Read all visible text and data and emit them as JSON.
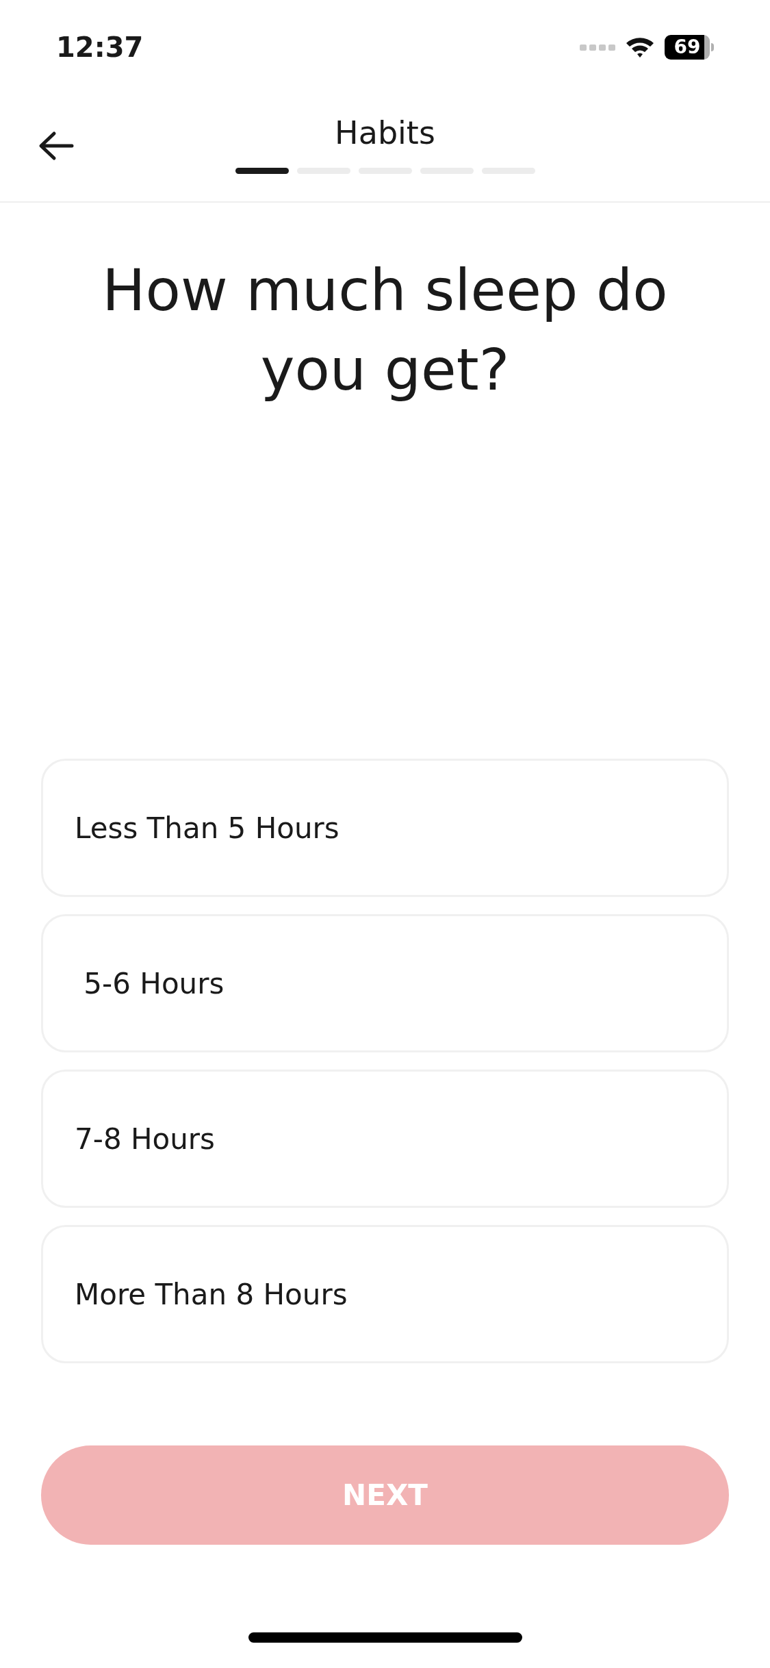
{
  "status_bar": {
    "time": "12:37",
    "battery": "69"
  },
  "header": {
    "title": "Habits",
    "steps": [
      {
        "selected": true
      },
      {
        "selected": false
      },
      {
        "selected": false
      },
      {
        "selected": false
      },
      {
        "selected": false
      }
    ]
  },
  "question": "How much sleep do you get?",
  "options": [
    {
      "label": "Less Than 5 Hours",
      "selected": false
    },
    {
      "label": " 5-6 Hours",
      "selected": false
    },
    {
      "label": "7-8 Hours",
      "selected": false
    },
    {
      "label": "More Than 8 Hours",
      "selected": false
    }
  ],
  "next_button": {
    "label": "NEXT",
    "disabled": true
  }
}
